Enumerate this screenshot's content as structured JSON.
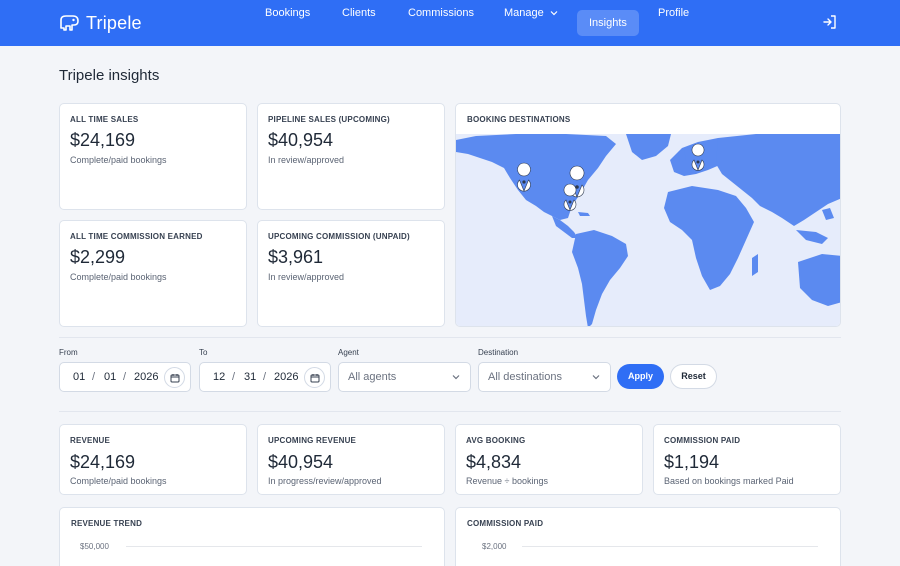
{
  "brand": {
    "name": "Tripele"
  },
  "nav": {
    "items": [
      {
        "label": "Bookings",
        "active": false
      },
      {
        "label": "Clients",
        "active": false
      },
      {
        "label": "Commissions",
        "active": false
      },
      {
        "label": "Manage",
        "active": false,
        "dropdown": true
      },
      {
        "label": "Insights",
        "active": true
      },
      {
        "label": "Profile",
        "active": false
      }
    ],
    "logout_icon": "logout-icon"
  },
  "page": {
    "title": "Tripele insights"
  },
  "summary_cards": [
    {
      "label": "ALL TIME SALES",
      "value": "$24,169",
      "sub": "Complete/paid bookings"
    },
    {
      "label": "PIPELINE SALES (UPCOMING)",
      "value": "$40,954",
      "sub": "In review/approved"
    },
    {
      "label": "ALL TIME COMMISSION EARNED",
      "value": "$2,299",
      "sub": "Complete/paid bookings"
    },
    {
      "label": "UPCOMING COMMISSION (UNPAID)",
      "value": "$3,961",
      "sub": "In review/approved"
    }
  ],
  "map": {
    "title": "BOOKING DESTINATIONS",
    "land_color": "#5b8af0",
    "ocean_color": "#e6ecfb"
  },
  "filters": {
    "from": {
      "label": "From",
      "month": "01",
      "day": "01",
      "year": "2026",
      "sep": "/"
    },
    "to": {
      "label": "To",
      "month": "12",
      "day": "31",
      "year": "2026",
      "sep": "/"
    },
    "agent": {
      "label": "Agent",
      "value": "All agents"
    },
    "destination": {
      "label": "Destination",
      "value": "All destinations"
    },
    "apply_label": "Apply",
    "reset_label": "Reset"
  },
  "metrics": [
    {
      "label": "REVENUE",
      "value": "$24,169",
      "sub": "Complete/paid bookings"
    },
    {
      "label": "UPCOMING REVENUE",
      "value": "$40,954",
      "sub": "In progress/review/approved"
    },
    {
      "label": "AVG BOOKING",
      "value": "$4,834",
      "sub": "Revenue ÷ bookings"
    },
    {
      "label": "COMMISSION PAID",
      "value": "$1,194",
      "sub": "Based on bookings marked Paid"
    }
  ],
  "charts": [
    {
      "title": "Revenue trend",
      "top_tick": "$50,000"
    },
    {
      "title": "Commission paid",
      "top_tick": "$2,000"
    }
  ],
  "colors": {
    "accent": "#2f6ef5",
    "nav_active": "#5a8cf7"
  }
}
